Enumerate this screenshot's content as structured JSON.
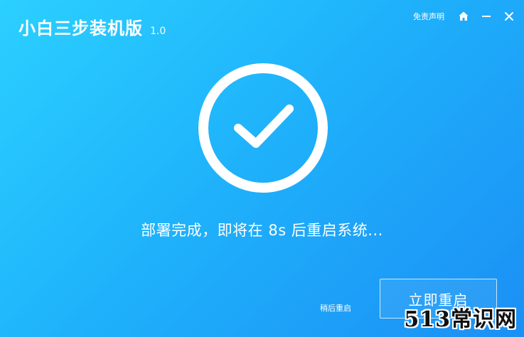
{
  "app": {
    "title": "小白三步装机版",
    "version": "1.0"
  },
  "header": {
    "disclaimer_label": "免责声明",
    "home_icon": "home-icon",
    "minimize_icon": "minimize-icon",
    "close_icon": "close-icon"
  },
  "main": {
    "status_icon": "check-circle-icon",
    "status_text": "部署完成，即将在 8s 后重启系统..."
  },
  "footer": {
    "later_label": "稍后重启",
    "restart_label": "立即重启"
  },
  "watermark": {
    "text": "513常识网"
  },
  "colors": {
    "background_start": "#2bd0ff",
    "background_end": "#1b8ff5",
    "foreground": "#ffffff"
  }
}
